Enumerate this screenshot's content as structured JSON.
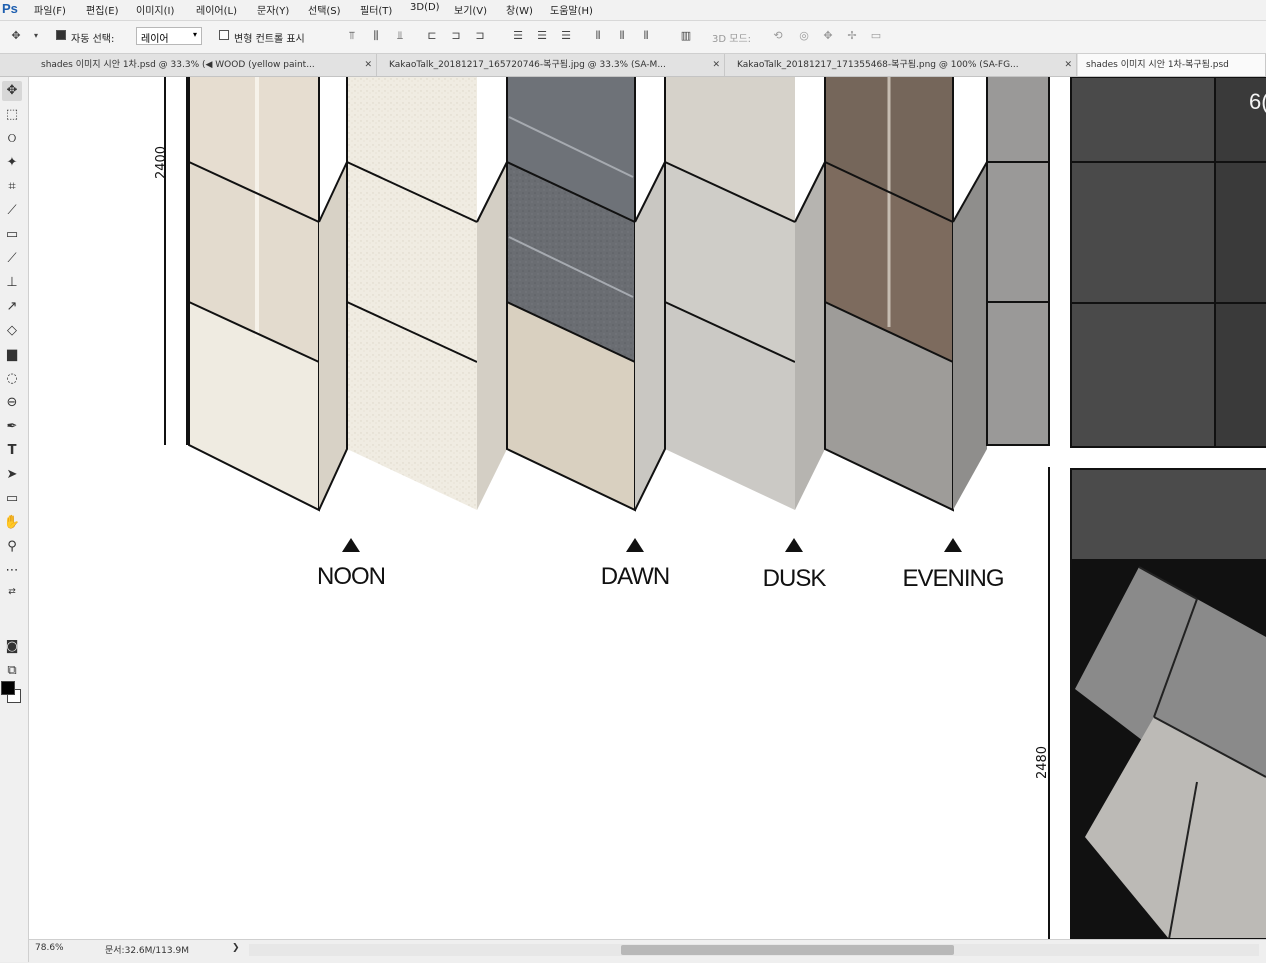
{
  "app": {
    "logo": "Ps"
  },
  "menu": [
    "파일(F)",
    "편집(E)",
    "이미지(I)",
    "레이어(L)",
    "문자(Y)",
    "선택(S)",
    "필터(T)",
    "3D(D)",
    "보기(V)",
    "창(W)",
    "도움말(H)"
  ],
  "options": {
    "auto_select_label": "자동 선택:",
    "auto_select_value": "레이어",
    "transform_controls_label": "변형 컨트롤 표시",
    "mode_3d_label": "3D 모드:"
  },
  "tabs": [
    {
      "label": "shades 이미지 시안 1차.psd @ 33.3% (◀ WOOD (yellow paint..."
    },
    {
      "label": "KakaoTalk_20181217_165720746-복구됨.jpg @ 33.3% (SA-M..."
    },
    {
      "label": "KakaoTalk_20181217_171355468-복구됨.png @ 100% (SA-FG..."
    },
    {
      "label": "shades 이미지 시안 1차-복구됨.psd"
    }
  ],
  "canvas": {
    "labels": [
      "NOON",
      "DAWN",
      "DUSK",
      "EVENING"
    ],
    "dim_left": "2400",
    "dim_right": "2480",
    "corner_text": "6("
  },
  "status": {
    "zoom": "78.6%",
    "doc": "문서:32.6M/113.9M",
    "arrow": "❯"
  },
  "tool_icons": [
    "move-icon",
    "marquee-icon",
    "lasso-icon",
    "magic-wand-icon",
    "crop-icon",
    "eyedropper-icon",
    "healing-icon",
    "brush-icon",
    "stamp-icon",
    "history-brush-icon",
    "eraser-icon",
    "gradient-icon",
    "blur-icon",
    "dodge-icon",
    "pen-icon",
    "type-icon",
    "path-select-icon",
    "shape-icon",
    "hand-icon",
    "zoom-icon",
    "more-icon",
    "swap-colors-icon",
    "quick-mask-icon",
    "screen-mode-icon"
  ]
}
